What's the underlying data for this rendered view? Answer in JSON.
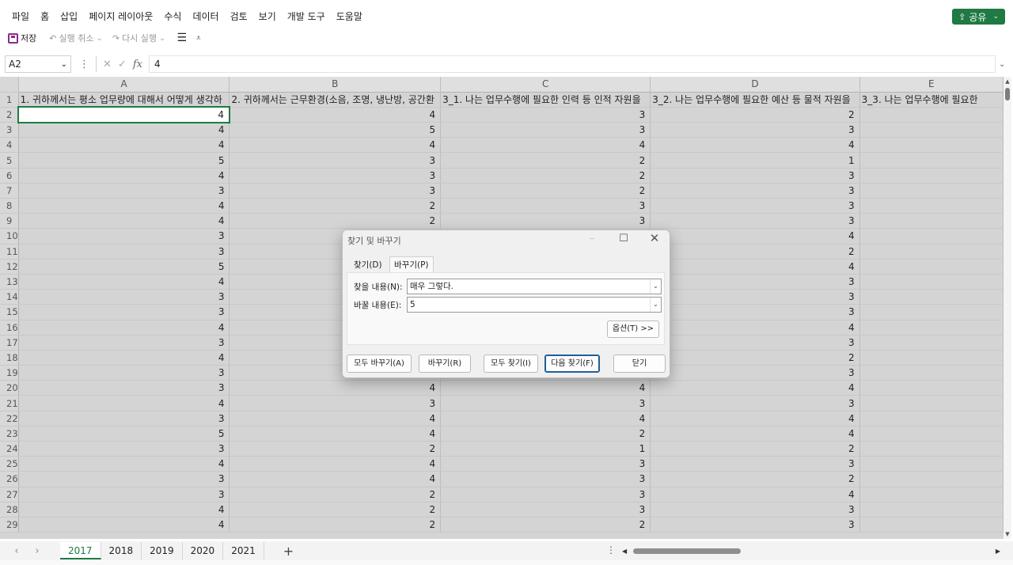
{
  "menu": [
    "파일",
    "홈",
    "삽입",
    "페이지 레이아웃",
    "수식",
    "데이터",
    "검토",
    "보기",
    "개발 도구",
    "도움말"
  ],
  "share": {
    "label": "공유"
  },
  "toolbar": {
    "save": "저장",
    "undo": "실행 취소",
    "redo": "다시 실행"
  },
  "formula_bar": {
    "name_box": "A2",
    "value": "4",
    "fx": "fx"
  },
  "columns": [
    {
      "letter": "A",
      "header": "1. 귀하께서는 평소 업무량에 대해서 어떻게 생각하"
    },
    {
      "letter": "B",
      "header": "2. 귀하께서는 근무환경(소음, 조명, 냉난방, 공간환"
    },
    {
      "letter": "C",
      "header": "3_1. 나는 업무수행에 필요한 인력 등 인적 자원을"
    },
    {
      "letter": "D",
      "header": "3_2. 나는 업무수행에 필요한 예산 등 물적 자원을"
    },
    {
      "letter": "E",
      "header": "3_3. 나는 업무수행에 필요한"
    }
  ],
  "rows": [
    {
      "num": "2",
      "values": [
        "4",
        "4",
        "3",
        "2",
        ""
      ]
    },
    {
      "num": "3",
      "values": [
        "4",
        "5",
        "3",
        "3",
        ""
      ]
    },
    {
      "num": "4",
      "values": [
        "4",
        "4",
        "4",
        "4",
        ""
      ]
    },
    {
      "num": "5",
      "values": [
        "5",
        "3",
        "2",
        "1",
        ""
      ]
    },
    {
      "num": "6",
      "values": [
        "4",
        "3",
        "2",
        "3",
        ""
      ]
    },
    {
      "num": "7",
      "values": [
        "3",
        "3",
        "2",
        "3",
        ""
      ]
    },
    {
      "num": "8",
      "values": [
        "4",
        "2",
        "3",
        "3",
        ""
      ]
    },
    {
      "num": "9",
      "values": [
        "4",
        "2",
        "3",
        "3",
        ""
      ]
    },
    {
      "num": "10",
      "values": [
        "3",
        "",
        "",
        "4",
        ""
      ]
    },
    {
      "num": "11",
      "values": [
        "3",
        "",
        "",
        "2",
        ""
      ]
    },
    {
      "num": "12",
      "values": [
        "5",
        "",
        "",
        "4",
        ""
      ]
    },
    {
      "num": "13",
      "values": [
        "4",
        "",
        "",
        "3",
        ""
      ]
    },
    {
      "num": "14",
      "values": [
        "3",
        "",
        "",
        "3",
        ""
      ]
    },
    {
      "num": "15",
      "values": [
        "3",
        "",
        "",
        "3",
        ""
      ]
    },
    {
      "num": "16",
      "values": [
        "4",
        "",
        "",
        "4",
        ""
      ]
    },
    {
      "num": "17",
      "values": [
        "3",
        "",
        "",
        "3",
        ""
      ]
    },
    {
      "num": "18",
      "values": [
        "4",
        "",
        "",
        "2",
        ""
      ]
    },
    {
      "num": "19",
      "values": [
        "3",
        "",
        "",
        "3",
        ""
      ]
    },
    {
      "num": "20",
      "values": [
        "3",
        "4",
        "4",
        "4",
        ""
      ]
    },
    {
      "num": "21",
      "values": [
        "4",
        "3",
        "3",
        "3",
        ""
      ]
    },
    {
      "num": "22",
      "values": [
        "3",
        "4",
        "4",
        "4",
        ""
      ]
    },
    {
      "num": "23",
      "values": [
        "5",
        "4",
        "2",
        "4",
        ""
      ]
    },
    {
      "num": "24",
      "values": [
        "3",
        "2",
        "1",
        "2",
        ""
      ]
    },
    {
      "num": "25",
      "values": [
        "4",
        "4",
        "3",
        "3",
        ""
      ]
    },
    {
      "num": "26",
      "values": [
        "3",
        "4",
        "3",
        "2",
        ""
      ]
    },
    {
      "num": "27",
      "values": [
        "3",
        "2",
        "3",
        "4",
        ""
      ]
    },
    {
      "num": "28",
      "values": [
        "4",
        "2",
        "3",
        "3",
        ""
      ]
    },
    {
      "num": "29",
      "values": [
        "4",
        "2",
        "2",
        "3",
        ""
      ]
    }
  ],
  "sheets": [
    {
      "name": "2017",
      "active": true
    },
    {
      "name": "2018",
      "active": false
    },
    {
      "name": "2019",
      "active": false
    },
    {
      "name": "2020",
      "active": false
    },
    {
      "name": "2021",
      "active": false
    }
  ],
  "dialog": {
    "title": "찾기 및 바꾸기",
    "tab_find": "찾기(D)",
    "tab_replace": "바꾸기(P)",
    "find_label": "찾을 내용(N):",
    "find_value": "매우 그렇다.",
    "replace_label": "바꿀 내용(E):",
    "replace_value": "5",
    "options": "옵션(T) >>",
    "replace_all": "모두 바꾸기(A)",
    "replace": "바꾸기(R)",
    "find_all": "모두 찾기(I)",
    "find_next": "다음 찾기(F)",
    "close": "닫기"
  },
  "colors": {
    "accent": "#1f7a43",
    "grid_shade": "#d4d4d4",
    "save_icon": "#8a2b8a"
  },
  "icons": [
    "save-icon",
    "undo-icon",
    "redo-icon",
    "align-icon",
    "customize-icon",
    "cancel-icon",
    "enter-icon",
    "function-icon",
    "share-icon"
  ]
}
